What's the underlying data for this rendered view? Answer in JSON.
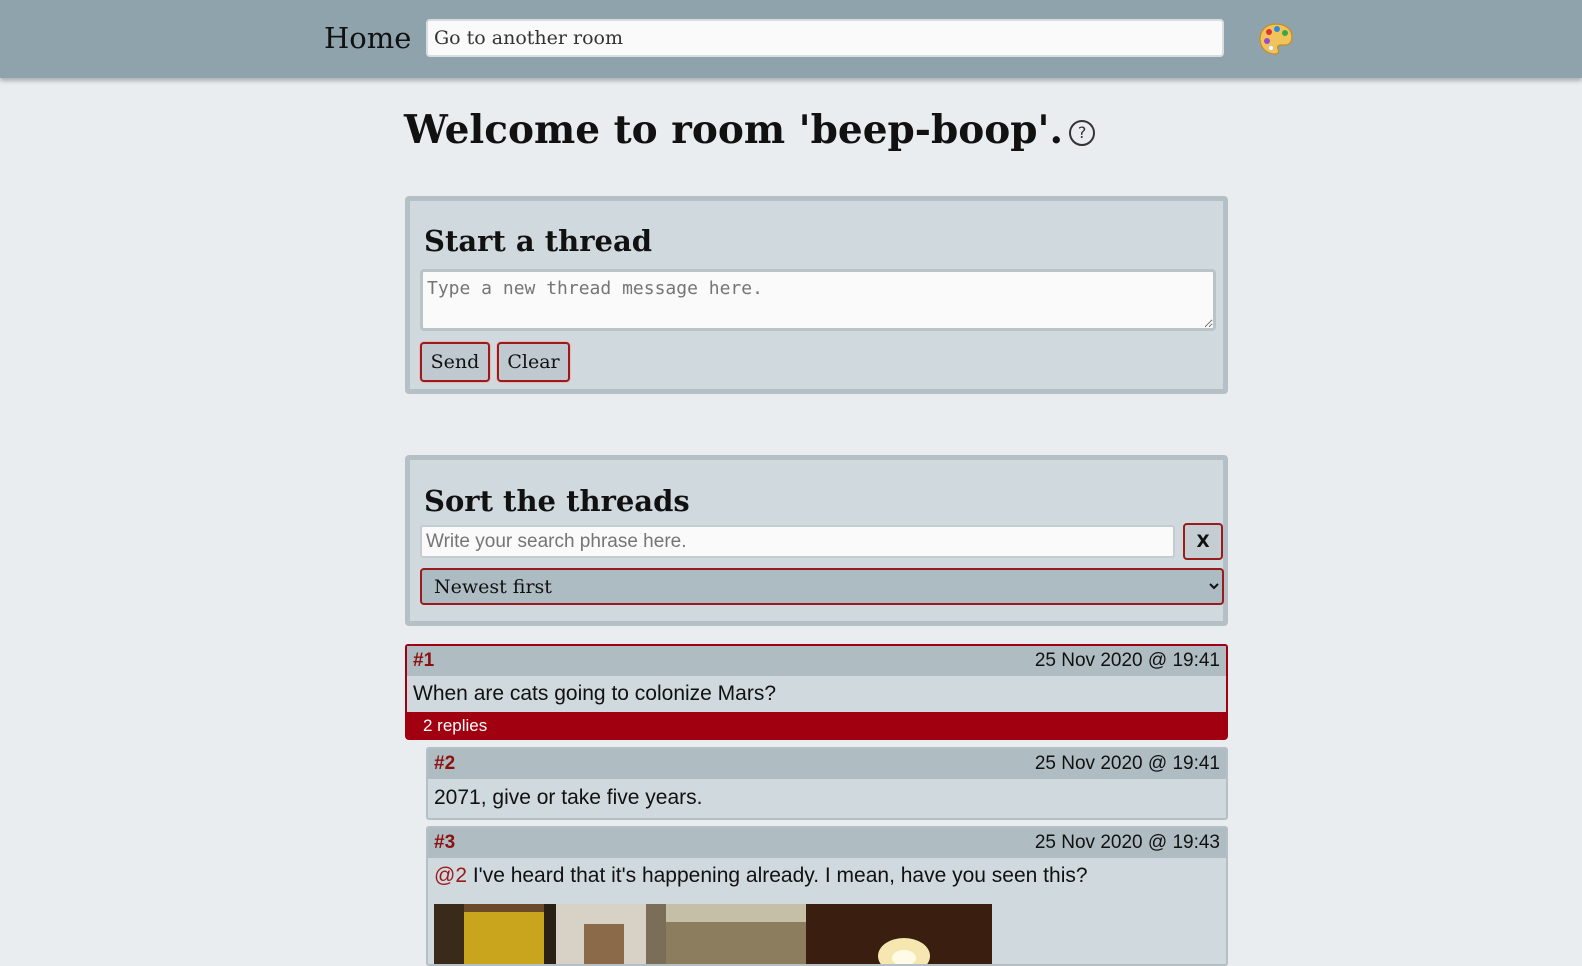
{
  "nav": {
    "home_label": "Home",
    "room_input_value": "Go to another room",
    "theme_icon": "palette-icon"
  },
  "title": {
    "text": "Welcome to room 'beep-boop'.",
    "help_icon": "?"
  },
  "new_thread": {
    "heading": "Start a thread",
    "placeholder": "Type a new thread message here.",
    "send_label": "Send",
    "clear_label": "Clear"
  },
  "sort": {
    "heading": "Sort the threads",
    "search_placeholder": "Write your search phrase here.",
    "clear_search_label": "X",
    "selected_option": "Newest first"
  },
  "threads": [
    {
      "number": "#1",
      "date": "25 Nov 2020 @ 19:41",
      "body": "When are cats going to colonize Mars?",
      "replies_label": "2 replies"
    }
  ],
  "replies": [
    {
      "number": "#2",
      "date": "25 Nov 2020 @ 19:41",
      "body": "2071, give or take five years."
    },
    {
      "number": "#3",
      "date": "25 Nov 2020 @ 19:43",
      "mention": "@2",
      "body": "I've heard that it's happening already. I mean, have you seen this?"
    }
  ],
  "colors": {
    "topbar": "#8fa3ad",
    "page_bg": "#e9edf0",
    "panel_bg": "#d0d9de",
    "accent": "#a00010"
  }
}
